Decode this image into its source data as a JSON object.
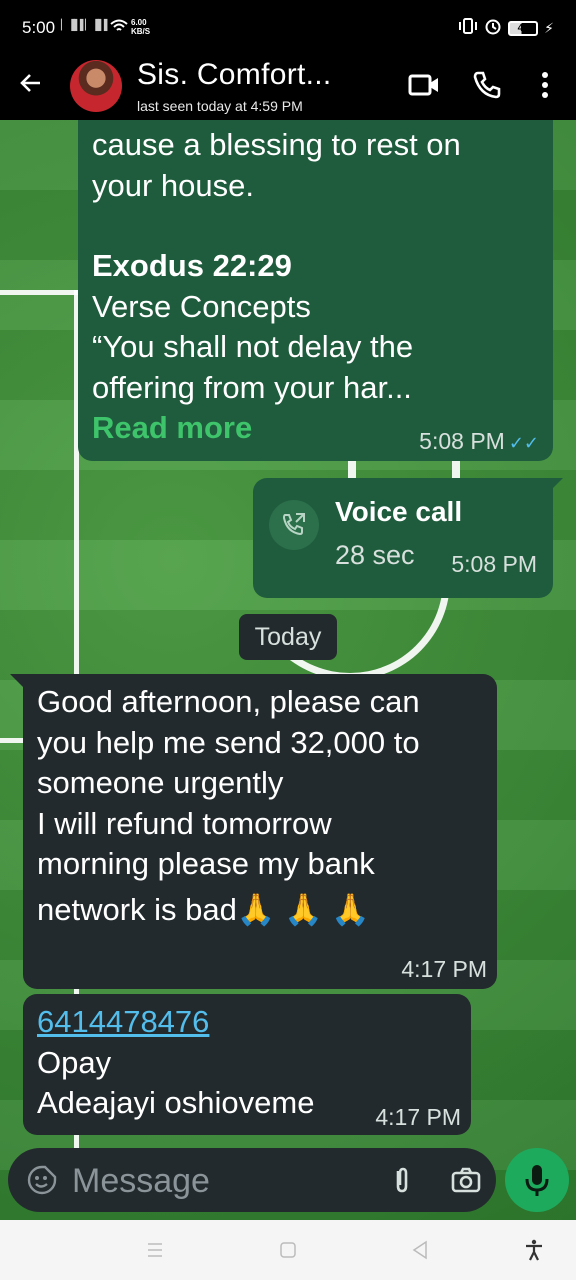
{
  "status_bar": {
    "time": "5:00",
    "signal1": "▏▐▌▌",
    "signal2": "▏▐▌▌",
    "speed_value": "6.00",
    "speed_unit": "KB/S",
    "battery": "43"
  },
  "header": {
    "contact_name": "Sis. Comfort...",
    "last_seen": "last seen today at 4:59 PM",
    "back_icon": "arrow-left-icon",
    "video_icon": "video-camera-icon",
    "call_icon": "phone-icon",
    "more_icon": "more-vertical-icon"
  },
  "messages": {
    "m1": {
      "line1": "cause a blessing to rest on",
      "line2": "your house.",
      "heading": "Exodus 22:29",
      "line3": "Verse Concepts",
      "line4": "“You shall not delay the",
      "line5": "offering from your har...",
      "read_more": "Read more",
      "time": "5:08 PM",
      "status": "read"
    },
    "m2": {
      "title": "Voice call",
      "duration": "28 sec",
      "time": "5:08 PM",
      "icon": "outgoing-call-icon"
    },
    "date_chip": "Today",
    "m3": {
      "line1": "Good afternoon, please can",
      "line2": "you help me send 32,000 to",
      "line3": "someone urgently",
      "line4": "I will refund tomorrow",
      "line5": "morning please my bank",
      "line6": "network is bad",
      "emoji": "🙏 🙏 🙏",
      "time": "4:17 PM"
    },
    "m4": {
      "account_number": "6414478476",
      "bank": "Opay",
      "name": "Adeajayi oshioveme",
      "time": "4:17 PM"
    }
  },
  "composer": {
    "placeholder": "Message",
    "emoji_icon": "emoji-sticker-icon",
    "attach_icon": "paperclip-icon",
    "camera_icon": "camera-icon",
    "mic_icon": "microphone-icon"
  },
  "colors": {
    "outgoing_bubble": "#1f5c3d",
    "incoming_bubble": "#232a2e",
    "accent_green": "#1eaa5c",
    "read_tick": "#53bdeb"
  }
}
